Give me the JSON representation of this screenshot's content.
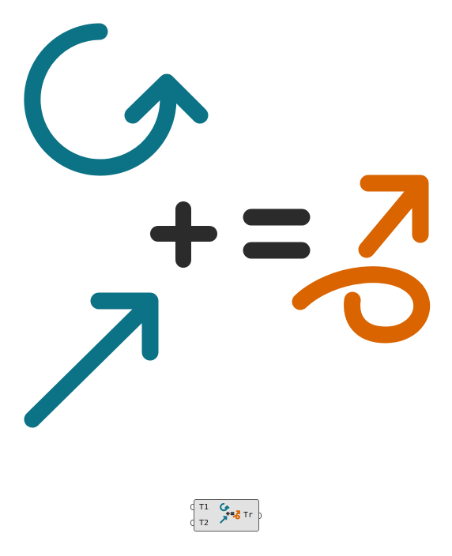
{
  "colors": {
    "teal": "#0c7285",
    "orange": "#d96400",
    "dark": "#2b2b2b",
    "component_fill": "#e2e2e2",
    "component_border": "#5a5a5a"
  },
  "illustration": {
    "rotation_icon": "rotation-arrow-icon",
    "plus_icon": "plus-icon",
    "translation_icon": "translation-arrow-icon",
    "equals_icon": "equals-icon",
    "result_icon": "combined-transform-icon"
  },
  "component": {
    "inputs": [
      {
        "label": "T1"
      },
      {
        "label": "T2"
      }
    ],
    "output": {
      "label": "Tr"
    },
    "icon": "compound-transform-icon"
  }
}
